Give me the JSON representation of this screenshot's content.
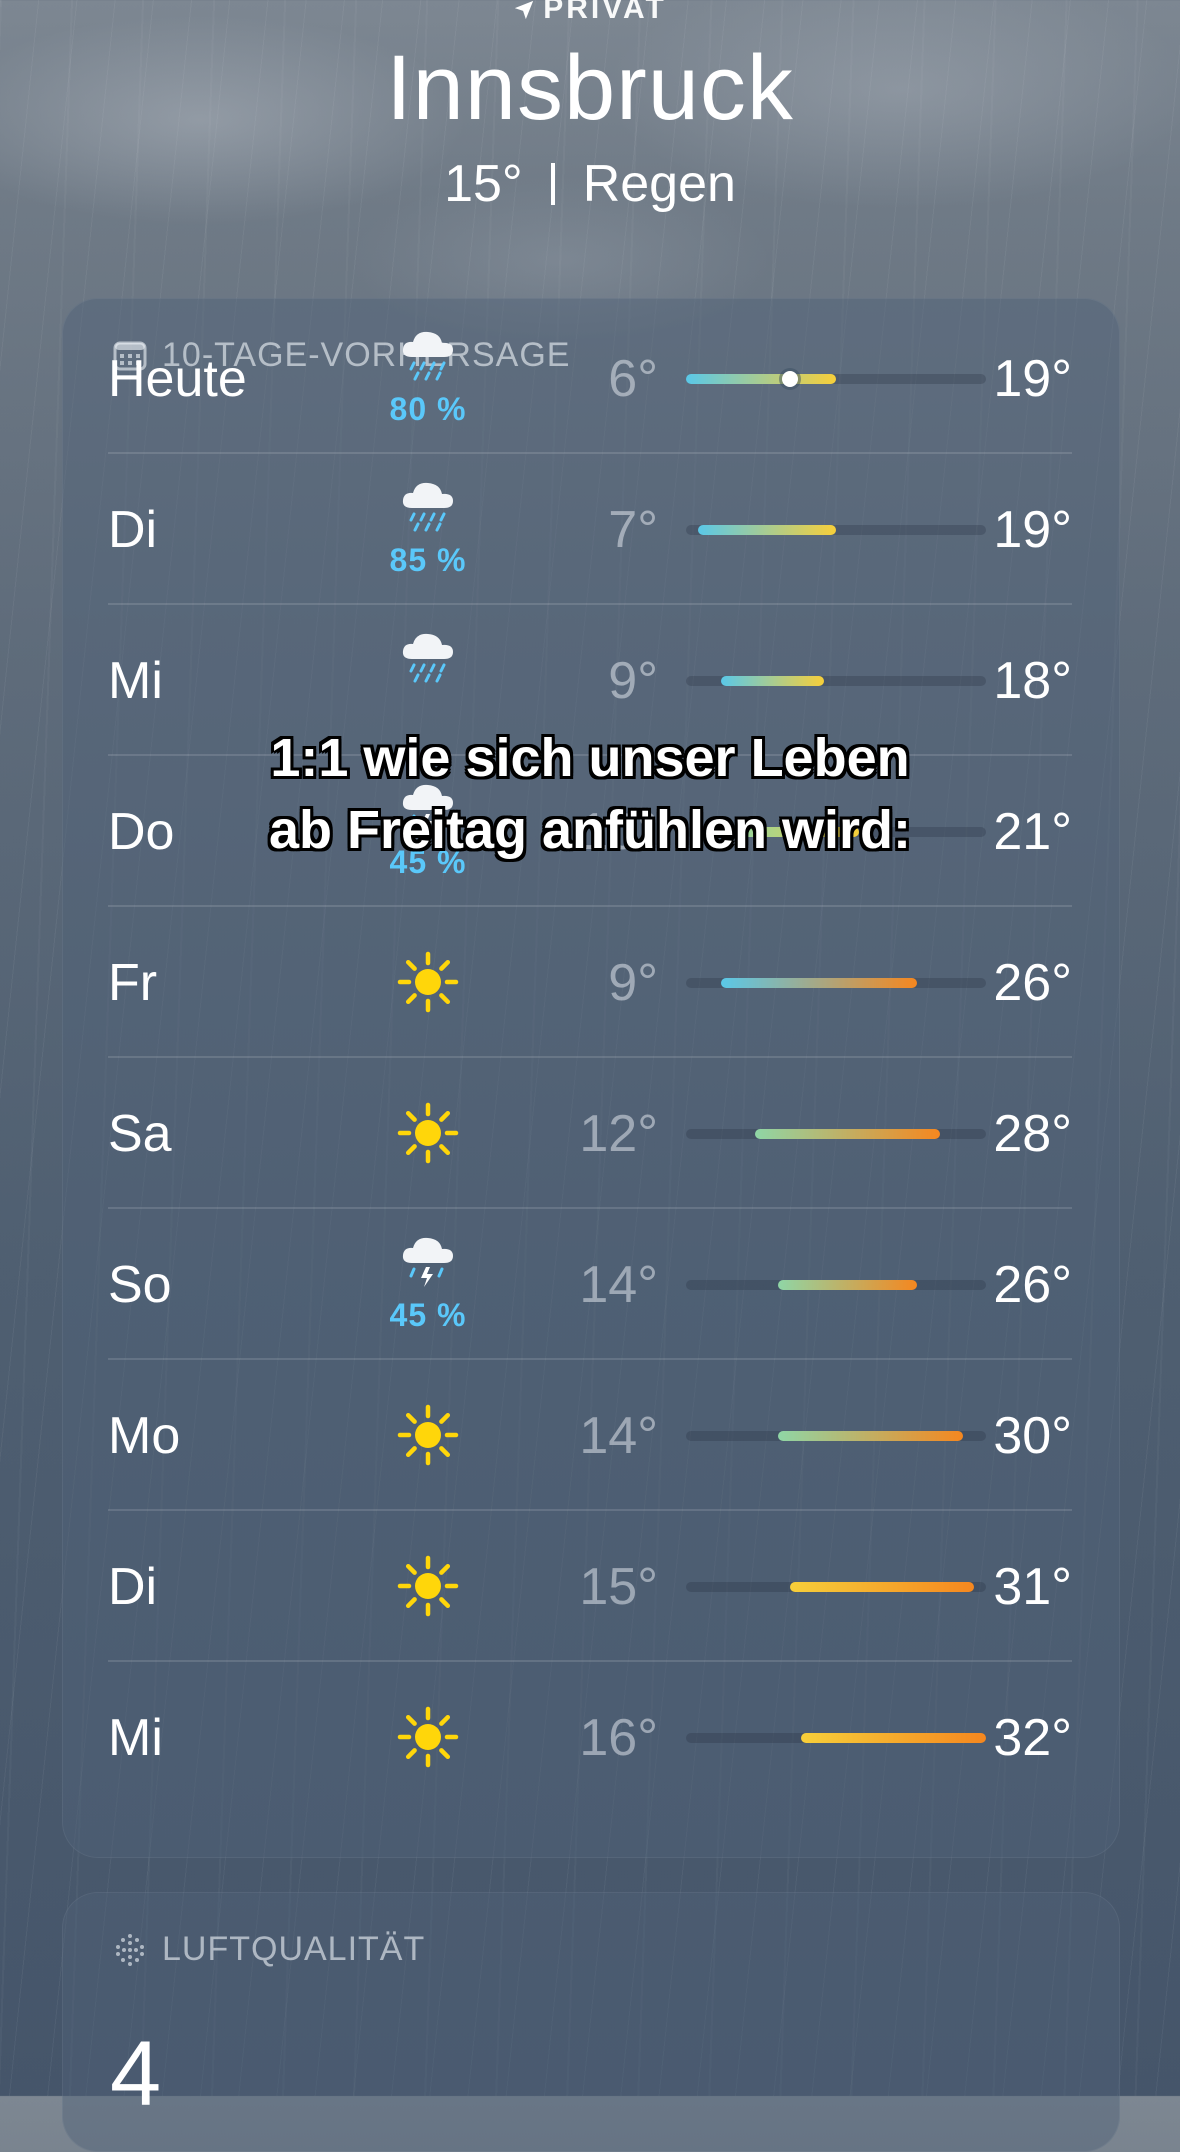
{
  "header": {
    "location_label": "PRIVAT",
    "city": "Innsbruck",
    "temperature": "15°",
    "condition": "Regen"
  },
  "forecast": {
    "title": "10-TAGE-VORHERSAGE",
    "scale_min": 6,
    "scale_max": 32,
    "current_temp": 15,
    "days": [
      {
        "day": "Heute",
        "icon": "cloud-rain-icon",
        "precip": "80 %",
        "low": "6°",
        "high": "19°",
        "low_val": 6,
        "high_val": 19
      },
      {
        "day": "Di",
        "icon": "cloud-rain-icon",
        "precip": "85 %",
        "low": "7°",
        "high": "19°",
        "low_val": 7,
        "high_val": 19
      },
      {
        "day": "Mi",
        "icon": "cloud-rain-icon",
        "precip": "",
        "low": "9°",
        "high": "18°",
        "low_val": 9,
        "high_val": 18
      },
      {
        "day": "Do",
        "icon": "cloud-bolt-rain-icon",
        "precip": "45 %",
        "low": "10°",
        "high": "21°",
        "low_val": 10,
        "high_val": 21
      },
      {
        "day": "Fr",
        "icon": "sun-icon",
        "precip": "",
        "low": "9°",
        "high": "26°",
        "low_val": 9,
        "high_val": 26
      },
      {
        "day": "Sa",
        "icon": "sun-icon",
        "precip": "",
        "low": "12°",
        "high": "28°",
        "low_val": 12,
        "high_val": 28
      },
      {
        "day": "So",
        "icon": "cloud-bolt-rain-icon",
        "precip": "45 %",
        "low": "14°",
        "high": "26°",
        "low_val": 14,
        "high_val": 26
      },
      {
        "day": "Mo",
        "icon": "sun-icon",
        "precip": "",
        "low": "14°",
        "high": "30°",
        "low_val": 14,
        "high_val": 30
      },
      {
        "day": "Di",
        "icon": "sun-icon",
        "precip": "",
        "low": "15°",
        "high": "31°",
        "low_val": 15,
        "high_val": 31
      },
      {
        "day": "Mi",
        "icon": "sun-icon",
        "precip": "",
        "low": "16°",
        "high": "32°",
        "low_val": 16,
        "high_val": 32
      }
    ]
  },
  "air_quality": {
    "title": "LUFTQUALITÄT",
    "value": "4"
  },
  "caption": {
    "line1": "1:1 wie sich unser Leben",
    "line2": "ab Freitag anfühlen wird:"
  },
  "colors": {
    "precip": "#5ac8fa",
    "cold": "#5ac8e8",
    "mild": "#8fd6a6",
    "warm": "#f7cf3a",
    "hot": "#f5871f"
  }
}
